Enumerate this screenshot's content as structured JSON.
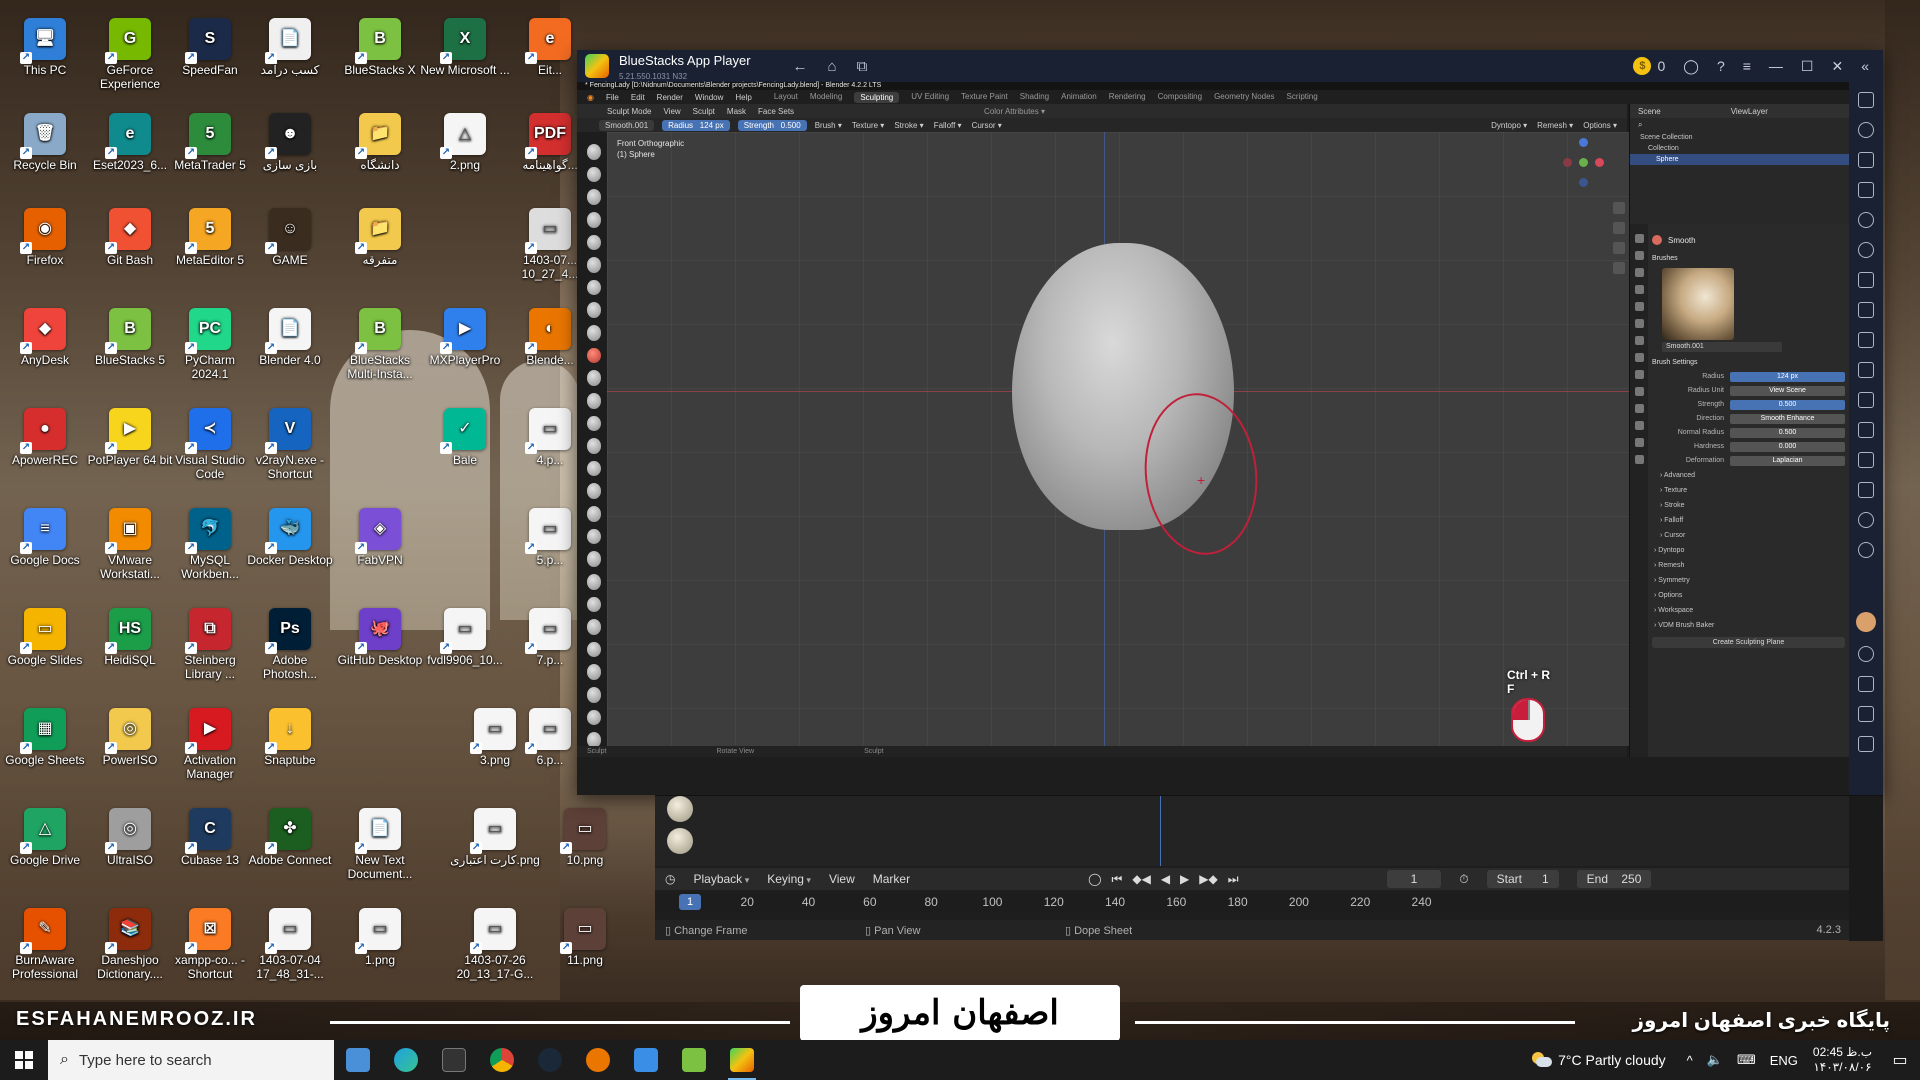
{
  "desktop": {
    "icons": [
      {
        "label": "This PC",
        "color": "#2f7fd8",
        "glyph": "🖥"
      },
      {
        "label": "GeForce Experience",
        "color": "#76b900",
        "glyph": "G"
      },
      {
        "label": "SpeedFan",
        "color": "#1b2a48",
        "glyph": "S"
      },
      {
        "label": "کسب درآمد",
        "color": "#f0f0f0",
        "glyph": "📄"
      },
      {
        "label": "BlueStacks X",
        "color": "#7cc142",
        "glyph": "B"
      },
      {
        "label": "New Microsoft ...",
        "color": "#1d7044",
        "glyph": "X"
      },
      {
        "label": "Eit...",
        "color": "#f26b21",
        "glyph": "e"
      },
      {
        "label": "Recycle Bin",
        "color": "#8aa9c8",
        "glyph": "🗑"
      },
      {
        "label": "Eset2023_6...",
        "color": "#0f8b8d",
        "glyph": "e"
      },
      {
        "label": "MetaTrader 5",
        "color": "#2c8c3c",
        "glyph": "5"
      },
      {
        "label": "بازی سازی",
        "color": "#222",
        "glyph": "☻"
      },
      {
        "label": "دانشگاه",
        "color": "#f2c94c",
        "glyph": "📁"
      },
      {
        "label": "2.png",
        "color": "#f5f5f5",
        "glyph": "△"
      },
      {
        "label": "گواهینامه...",
        "color": "#d32f2f",
        "glyph": "PDF"
      },
      {
        "label": "Firefox",
        "color": "#e66000",
        "glyph": "◉"
      },
      {
        "label": "Git Bash",
        "color": "#f05133",
        "glyph": "◆"
      },
      {
        "label": "MetaEditor 5",
        "color": "#f5a623",
        "glyph": "5"
      },
      {
        "label": "GAME",
        "color": "#3a2c1e",
        "glyph": "☺"
      },
      {
        "label": "متفرقه",
        "color": "#f2c94c",
        "glyph": "📁"
      },
      {
        "label": "1403-07... 10_27_4...",
        "color": "#dddddd",
        "glyph": "▭"
      },
      {
        "label": "AnyDesk",
        "color": "#ef443b",
        "glyph": "◆"
      },
      {
        "label": "BlueStacks 5",
        "color": "#7cc142",
        "glyph": "B"
      },
      {
        "label": "PyCharm 2024.1",
        "color": "#21d789",
        "glyph": "PC"
      },
      {
        "label": "Blender 4.0",
        "color": "#f5f5f5",
        "glyph": "📄"
      },
      {
        "label": "BlueStacks Multi-Insta...",
        "color": "#7cc142",
        "glyph": "B"
      },
      {
        "label": "MXPlayerPro",
        "color": "#2f80ed",
        "glyph": "▶"
      },
      {
        "label": "Blende...",
        "color": "#ea7600",
        "glyph": "◐"
      },
      {
        "label": "ApowerREC",
        "color": "#d62d2d",
        "glyph": "●"
      },
      {
        "label": "PotPlayer 64 bit",
        "color": "#f7d51d",
        "glyph": "▶"
      },
      {
        "label": "Visual Studio Code",
        "color": "#1f6feb",
        "glyph": "≺"
      },
      {
        "label": "v2rayN.exe - Shortcut",
        "color": "#1565c0",
        "glyph": "V"
      },
      {
        "label": "Bale",
        "color": "#00b894",
        "glyph": "✓"
      },
      {
        "label": "4.p...",
        "color": "#f5f5f5",
        "glyph": "▭"
      },
      {
        "label": "Google Docs",
        "color": "#4285f4",
        "glyph": "≡"
      },
      {
        "label": "VMware Workstati...",
        "color": "#f38b00",
        "glyph": "▣"
      },
      {
        "label": "MySQL Workben...",
        "color": "#00618a",
        "glyph": "🐬"
      },
      {
        "label": "Docker Desktop",
        "color": "#2496ed",
        "glyph": "🐳"
      },
      {
        "label": "FabVPN",
        "color": "#7b4fd6",
        "glyph": "◈"
      },
      {
        "label": "5.p...",
        "color": "#f5f5f5",
        "glyph": "▭"
      },
      {
        "label": "Google Slides",
        "color": "#f4b400",
        "glyph": "▭"
      },
      {
        "label": "HeidiSQL",
        "color": "#1b9e47",
        "glyph": "HS"
      },
      {
        "label": "Steinberg Library ...",
        "color": "#c6262e",
        "glyph": "⧉"
      },
      {
        "label": "Adobe Photosh...",
        "color": "#001e36",
        "glyph": "Ps"
      },
      {
        "label": "GitHub Desktop",
        "color": "#6e40c9",
        "glyph": "🐙"
      },
      {
        "label": "fvdl9906_10...",
        "color": "#f5f5f5",
        "glyph": "▭"
      },
      {
        "label": "7.p...",
        "color": "#f5f5f5",
        "glyph": "▭"
      },
      {
        "label": "Google Sheets",
        "color": "#0f9d58",
        "glyph": "▦"
      },
      {
        "label": "PowerISO",
        "color": "#f2c94c",
        "glyph": "◎"
      },
      {
        "label": "Activation Manager",
        "color": "#d71920",
        "glyph": "▶"
      },
      {
        "label": "Snaptube",
        "color": "#fbc02d",
        "glyph": "↓"
      },
      {
        "label": "3.png",
        "color": "#f5f5f5",
        "glyph": "▭"
      },
      {
        "label": "6.p...",
        "color": "#f5f5f5",
        "glyph": "▭"
      },
      {
        "label": "Google Drive",
        "color": "#1fa463",
        "glyph": "△"
      },
      {
        "label": "UltraISO",
        "color": "#9e9e9e",
        "glyph": "◎"
      },
      {
        "label": "Cubase 13",
        "color": "#1e3a5f",
        "glyph": "C"
      },
      {
        "label": "Adobe Connect",
        "color": "#1b5e20",
        "glyph": "✤"
      },
      {
        "label": "New Text Document...",
        "color": "#f5f5f5",
        "glyph": "📄"
      },
      {
        "label": "کارت اعتباری.png",
        "color": "#f5f5f5",
        "glyph": "▭"
      },
      {
        "label": "10.png",
        "color": "#5d4037",
        "glyph": "▭"
      },
      {
        "label": "BurnAware Professional",
        "color": "#e65100",
        "glyph": "✎"
      },
      {
        "label": "Daneshjoo Dictionary....",
        "color": "#8d2c0c",
        "glyph": "📚"
      },
      {
        "label": "xampp-co... - Shortcut",
        "color": "#fb7a24",
        "glyph": "⊠"
      },
      {
        "label": "1403-07-04 17_48_31-...",
        "color": "#f5f5f5",
        "glyph": "▭"
      },
      {
        "label": "1.png",
        "color": "#f5f5f5",
        "glyph": "▭"
      },
      {
        "label": "1403-07-26 20_13_17-G...",
        "color": "#f5f5f5",
        "glyph": "▭"
      },
      {
        "label": "11.png",
        "color": "#5d4037",
        "glyph": "▭"
      }
    ]
  },
  "banner": {
    "left": "ESFAHANEMROOZ.IR",
    "logo": "اصفهان امروز",
    "right": "پایگاه خبری اصفهان امروز"
  },
  "taskbar": {
    "search_placeholder": "Type here to search",
    "weather": "7°C  Partly cloudy",
    "lang": "ENG",
    "time": "02:45 ب.ظ",
    "date": "۱۴۰۳/۰۸/۰۶"
  },
  "bluestacks": {
    "title": "BlueStacks App Player",
    "version": "5.21.550.1031 N32",
    "coins": "0"
  },
  "blender": {
    "file_title": "* FencingLady [D:\\Nidnum\\Documents\\Blender projects\\FencingLady.blend] - Blender 4.2.2 LTS",
    "menus": [
      "File",
      "Edit",
      "Render",
      "Window",
      "Help"
    ],
    "workspaces": [
      "Layout",
      "Modeling",
      "Sculpting",
      "UV Editing",
      "Texture Paint",
      "Shading",
      "Animation",
      "Rendering",
      "Compositing",
      "Geometry Nodes",
      "Scripting"
    ],
    "active_workspace": "Sculpting",
    "header_items": [
      "Sculpt Mode",
      "View",
      "Sculpt",
      "Mask",
      "Face Sets"
    ],
    "tool_row": {
      "brush": "Smooth.001",
      "radius_label": "Radius",
      "radius": "124 px",
      "strength_label": "Strength",
      "strength": "0.500",
      "menus": [
        "Brush",
        "Texture",
        "Stroke",
        "Falloff",
        "Cursor"
      ],
      "right": [
        "Dyntopo",
        "Remesh",
        "Options"
      ]
    },
    "viewport": {
      "view_name": "Front Orthographic",
      "object": "(1) Sphere",
      "shortcut_line1": "Ctrl + R",
      "shortcut_line2": "F"
    },
    "status": [
      "Sculpt",
      "Rotate View",
      "Sculpt"
    ],
    "outliner": {
      "scene": "Scene",
      "view_layer": "ViewLayer",
      "rows": [
        "Scene Collection",
        "Collection",
        "Sphere"
      ]
    },
    "properties": {
      "tool_name": "Smooth",
      "brushes_label": "Brushes",
      "brush_asset": "Smooth.001",
      "brush_settings": "Brush Settings",
      "rows": [
        {
          "label": "Radius",
          "value": "124 px",
          "blue": true
        },
        {
          "label": "Radius Unit",
          "value": "View   Scene",
          "blue": false
        },
        {
          "label": "Strength",
          "value": "0.500",
          "blue": true
        },
        {
          "label": "Direction",
          "value": "Smooth   Enhance",
          "blue": false
        },
        {
          "label": "Normal Radius",
          "value": "0.500",
          "blue": false
        },
        {
          "label": "Hardness",
          "value": "0.000",
          "blue": false
        },
        {
          "label": "Deformation",
          "value": "Laplacian",
          "blue": false
        }
      ],
      "subpanels": [
        "Advanced",
        "Texture",
        "Stroke",
        "Falloff",
        "Cursor"
      ],
      "panels": [
        "Dyntopo",
        "Remesh",
        "Symmetry",
        "Options",
        "Workspace",
        "VDM Brush Baker"
      ],
      "create_button": "Create Sculpting Plane"
    }
  },
  "timeline": {
    "menus": [
      "Playback",
      "Keying",
      "View",
      "Marker"
    ],
    "current_frame": "1",
    "start_label": "Start",
    "start": "1",
    "end_label": "End",
    "end": "250",
    "ticks": [
      "1",
      "20",
      "40",
      "60",
      "80",
      "100",
      "120",
      "140",
      "160",
      "180",
      "200",
      "220",
      "240"
    ],
    "footer": [
      "Change Frame",
      "Pan View",
      "Dope Sheet"
    ],
    "version": "4.2.3"
  }
}
